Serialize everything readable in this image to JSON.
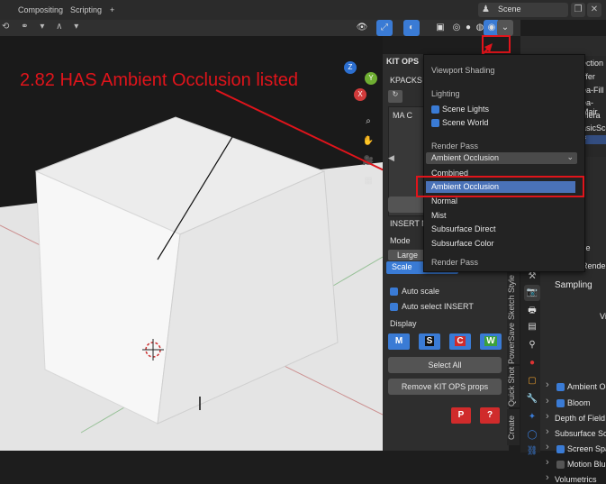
{
  "topbar": {
    "tab_compositing": "Compositing",
    "tab_scripting": "Scripting",
    "tab_add": "+",
    "scene_value": "Scene"
  },
  "annotation": {
    "text": "2.82 HAS Ambient Occlusion listed"
  },
  "kitops": {
    "header": "KIT OPS",
    "kpacks": "KPACKS",
    "ma_label": "MA C",
    "insert_label": "INSERT Na",
    "mode_label": "Mode",
    "large_label": "Large",
    "scale_label": "Scale",
    "auto_scale": "Auto scale",
    "auto_select": "Auto select INSERT",
    "display": "Display",
    "badges": [
      "M",
      "S",
      "C",
      "W"
    ],
    "select_all": "Select All",
    "remove_props": "Remove KIT OPS props",
    "p_btn": "P",
    "q_btn": "?"
  },
  "vtabs": [
    "Sketch Style",
    "PowerSave",
    "Quick Shot",
    "Create"
  ],
  "shading": {
    "title": "Viewport Shading",
    "lighting": "Lighting",
    "scene_lights": "Scene Lights",
    "scene_world": "Scene World",
    "render_pass": "Render Pass",
    "selected": "Ambient Occlusion",
    "options": [
      "Combined",
      "Ambient Occlusion",
      "Normal",
      "Mist",
      "Subsurface Direct",
      "Subsurface Color"
    ],
    "footer": "Render Pass"
  },
  "outliner": {
    "items": [
      "ection",
      "ffer",
      "ea-Fill",
      "ea-Mair",
      "mera",
      "asicSce",
      "ff"
    ]
  },
  "properties": {
    "scene_label": "cene",
    "render_label": "Rende",
    "sampling": "Sampling",
    "vi_label": "Vi",
    "rows": [
      {
        "label": "Ambient Oc",
        "checked": true
      },
      {
        "label": "Bloom",
        "checked": true
      },
      {
        "label": "Depth of Field",
        "checked": null
      },
      {
        "label": "Subsurface Sca",
        "checked": null
      },
      {
        "label": "Screen Spa",
        "checked": true
      },
      {
        "label": "Motion Blu",
        "checked": false
      },
      {
        "label": "Volumetrics",
        "checked": null
      }
    ]
  },
  "colors": {
    "annotation_red": "#e0141b",
    "accent_blue": "#3a7bd5",
    "viewport_bg": "#3d3d3d"
  },
  "gizmo": {
    "x": "X",
    "y": "Y",
    "z": "Z"
  }
}
